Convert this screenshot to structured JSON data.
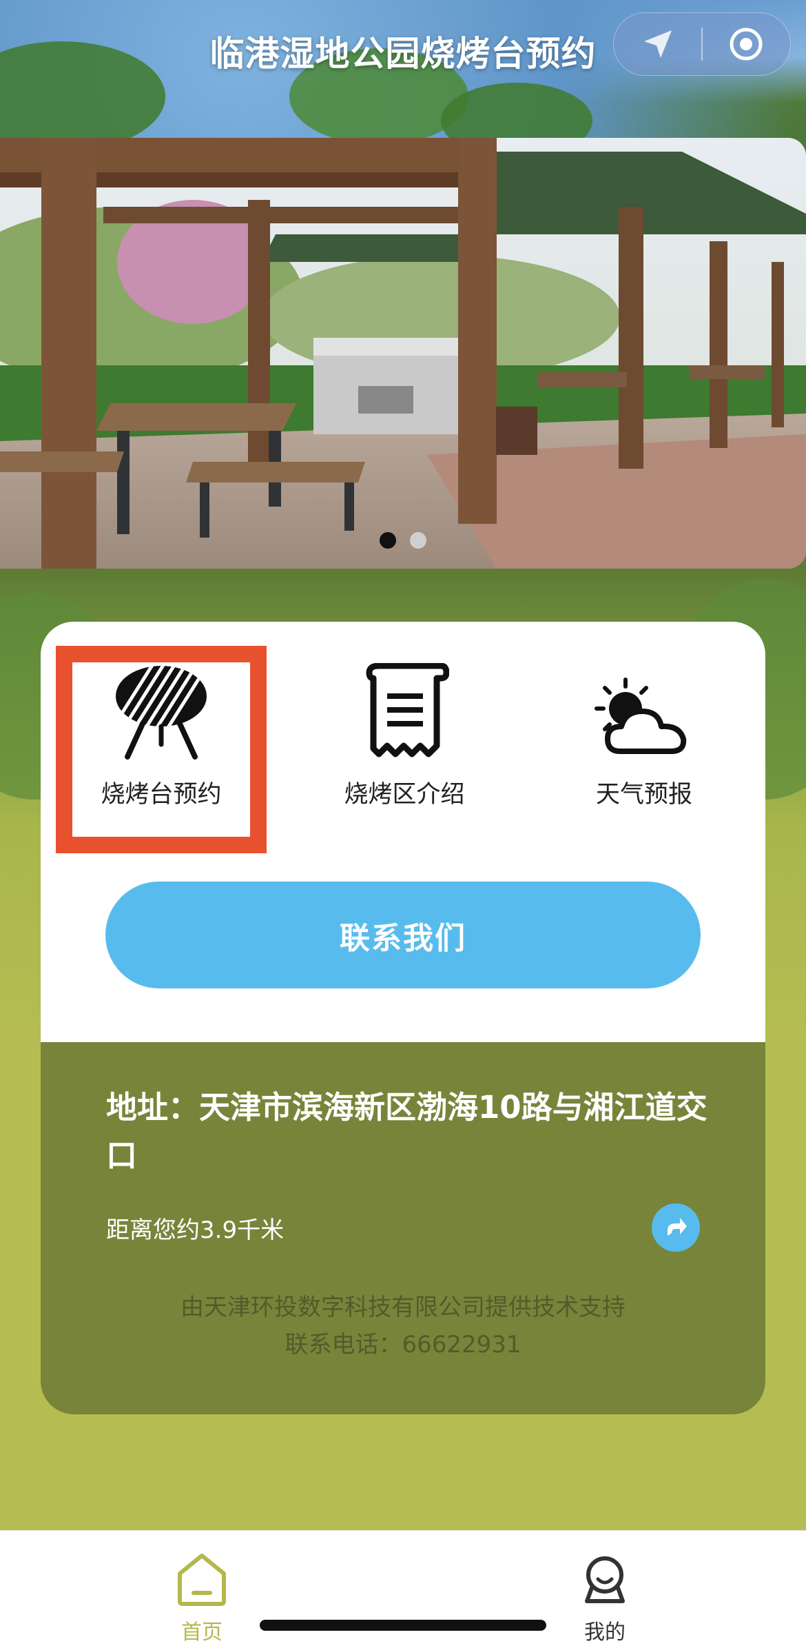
{
  "header": {
    "title": "临港湿地公园烧烤台预约"
  },
  "capsule": {
    "location_icon": "location-arrow-icon",
    "record_icon": "target-circle-icon"
  },
  "carousel": {
    "image": "bbq-pavilion-photo",
    "slide_count": 2,
    "active_slide": 1
  },
  "features": [
    {
      "label": "烧烤台预约",
      "icon": "grill-icon"
    },
    {
      "label": "烧烤区介绍",
      "icon": "scroll-document-icon"
    },
    {
      "label": "天气预报",
      "icon": "sun-cloud-icon"
    }
  ],
  "contact_button": "联系我们",
  "address": {
    "text": "地址：天津市滨海新区渤海10路与湘江道交口",
    "distance": "距离您约3.9千米",
    "share_icon": "share-arrow-icon"
  },
  "footer": {
    "line1": "由天津环投数字科技有限公司提供技术支持",
    "line2": "联系电话：66622931"
  },
  "tabbar": {
    "items": [
      {
        "label": "首页",
        "icon": "home-icon",
        "active": true
      },
      {
        "label": "我的",
        "icon": "profile-icon",
        "active": false
      }
    ],
    "active_color": "#b5b84a",
    "inactive_color": "#333333"
  },
  "colors": {
    "accent_blue": "#57bced",
    "highlight_red": "#e8512e",
    "panel_olive": "#78843a",
    "page_green": "#b5bd52"
  }
}
